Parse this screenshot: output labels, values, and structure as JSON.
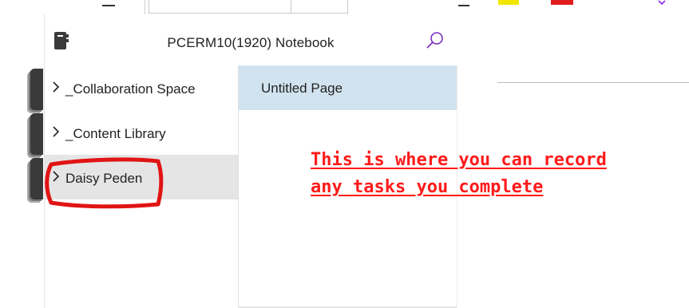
{
  "toolbar": {
    "swatch_colors": [
      "#f2e600",
      "#e01b1b"
    ]
  },
  "notebook": {
    "title": "PCERM10(1920) Notebook",
    "notebook_icon": "notebook-icon",
    "search_icon": "search-icon"
  },
  "sections": [
    {
      "label": "_Collaboration Space",
      "selected": false,
      "icon": "chevron-right-icon"
    },
    {
      "label": "_Content Library",
      "selected": false,
      "icon": "chevron-right-icon"
    },
    {
      "label": "Daisy Peden",
      "selected": true,
      "icon": "chevron-right-icon"
    }
  ],
  "pages": [
    {
      "label": "Untitled Page",
      "selected": true
    }
  ],
  "annotation": {
    "line1": "This is where you can record",
    "line2": "any tasks you complete",
    "color": "#ff1a1a"
  },
  "colors": {
    "accent_purple": "#8a2be2",
    "selected_page_bg": "#d1e3ef",
    "selected_section_bg": "#e5e5e5"
  }
}
